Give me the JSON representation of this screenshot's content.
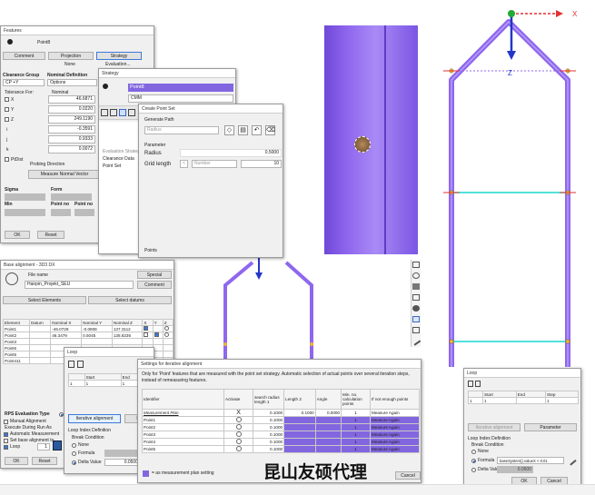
{
  "features": {
    "title": "Features",
    "feature_name": "Point8",
    "tabs": [
      "Comment",
      "Projection",
      "Strategy"
    ],
    "projection_value": "None",
    "evaluation_label": "Evaluation...",
    "clearance_group_label": "Clearance Group",
    "clearance_group_value": "CP +Y",
    "nominal_definition_label": "Nominal Definition",
    "nominal_definition_value": "Options",
    "tolerance_label": "Tolerance For:",
    "nominal_label": "Nominal",
    "rows": [
      {
        "label": "X",
        "value": "46.6871"
      },
      {
        "label": "Y",
        "value": "0.0220"
      },
      {
        "label": "Z",
        "value": "249.1190"
      },
      {
        "label": "i",
        "value": "-0.3591"
      },
      {
        "label": "j",
        "value": "0.9333"
      },
      {
        "label": "k",
        "value": "0.0072"
      }
    ],
    "pdist_label": "PtDist",
    "probing_direction_label": "Probing Direction",
    "measure_normal_button": "Measure Normal Vector",
    "sigma_label": "Sigma",
    "form_label": "Form",
    "min_label": "Min",
    "point_no_label": "Point no",
    "ok_button": "OK",
    "reset_button": "Reset"
  },
  "strategy": {
    "title": "Strategy",
    "path_item": "Point8",
    "machine_value": "CMM",
    "tree_items": [
      "Evaluation Strategy",
      "Clearance Data",
      "Point Set"
    ]
  },
  "create_point_set": {
    "title": "Create Point Set",
    "generate_path_label": "Generate Path",
    "path_type": "Radius",
    "parameter_label": "Parameter",
    "radius_label": "Radius",
    "radius_value": "0.5000",
    "grid_length_label": "Grid length",
    "grid_mode": "Number",
    "grid_value": "10",
    "points_label": "Points"
  },
  "base_alignment": {
    "title": "Base alignment - 3D3 DX",
    "file_name_label": "File name",
    "file_name_value": "Hairpin_Projekt_SEU",
    "special_button": "Special",
    "comment_button": "Comment",
    "select_elements_button": "Select Elements",
    "select_datums_button": "Select datums",
    "columns": [
      "Element",
      "Datum",
      "Nominal X",
      "Nominal Y",
      "Nominal Z",
      "X",
      "Y",
      "Z"
    ],
    "rows": [
      [
        "Point1",
        "",
        "-46.0729",
        "-0.0808",
        "137.3112"
      ],
      [
        "Point2",
        "",
        "46.3479",
        "0.5045",
        "138.8236"
      ],
      [
        "Point3",
        "",
        "",
        "",
        ""
      ],
      [
        "Point6",
        "",
        "",
        "",
        ""
      ],
      [
        "Point5",
        "",
        "",
        "",
        ""
      ],
      [
        "Point411",
        "",
        "",
        "",
        ""
      ]
    ],
    "rps_label": "RPS Evaluation Type",
    "options": [
      "Manual Alignment",
      "Execute During Run As",
      "Automatic Measurement",
      "Set base alignment to",
      "Loop"
    ],
    "loop_value": "1",
    "ok_button": "OK",
    "reset_button": "Reset"
  },
  "loop": {
    "title": "Loop",
    "columns": [
      "Start",
      "End"
    ],
    "start_value": "1",
    "end_value": "1",
    "iterative_button": "Iterative alignment",
    "parameter_button": "P",
    "loop_index_label": "Loop Index Definition",
    "break_condition_label": "Break Condition",
    "options": [
      "None",
      "Formula",
      "Delta Value"
    ],
    "delta_value": "0.0500"
  },
  "settings_table": {
    "title": "Settings for iterative alignment",
    "description": "Only for 'Point' features that are measured with the point set strategy. Automatic selection of actual points over several iteration steps, instead of remeasuring features.",
    "columns": [
      "Identifier",
      "Activate",
      "search radius length 1",
      "Length 2",
      "Angle",
      "Min. no. calculation points",
      "If not enough points"
    ],
    "rows": [
      [
        "Measurement Plan",
        "X",
        "0.1000",
        "0.1000",
        "0.0000",
        "1",
        "Measure Again"
      ],
      [
        "Point1",
        "",
        "0.1000",
        "",
        "",
        "1",
        "Measure Again"
      ],
      [
        "Point2",
        "",
        "0.1000",
        "",
        "",
        "1",
        "Measure Again"
      ],
      [
        "Point3",
        "",
        "0.1000",
        "",
        "",
        "1",
        "Measure Again"
      ],
      [
        "Point4",
        "",
        "0.1000",
        "",
        "",
        "1",
        "Measure Again"
      ],
      [
        "Point5",
        "",
        "0.1000",
        "",
        "",
        "1",
        "Measure Again"
      ]
    ],
    "legend": "= as measurement plan setting",
    "cancel_button": "Cancel"
  },
  "loop_small": {
    "title": "Loop",
    "columns": [
      "Start",
      "End",
      "Step"
    ],
    "start_value": "1",
    "end_value": "",
    "step_value": "1",
    "iterative_button": "Iterative alignment",
    "parameter_button": "Parameter",
    "loop_index_label": "Loop Index Definition",
    "break_condition_label": "Break Condition",
    "options": [
      "None",
      "Formula",
      "Delta Value"
    ],
    "formula_value": "baseSystem().valueX < 0.01",
    "delta_value": "0.0500",
    "ok_button": "OK",
    "cancel_button": "Cancel"
  },
  "viewport": {
    "axis_x": "X",
    "axis_z": "Z"
  },
  "watermark": "昆山友硕代理",
  "colors": {
    "model": "#8f67ee",
    "selection_lines": "#19d8d0",
    "axis_x": "#e23232",
    "axis_z": "#2336c8",
    "axis_origin": "#22aa33",
    "table_highlight": "#8266e0"
  }
}
